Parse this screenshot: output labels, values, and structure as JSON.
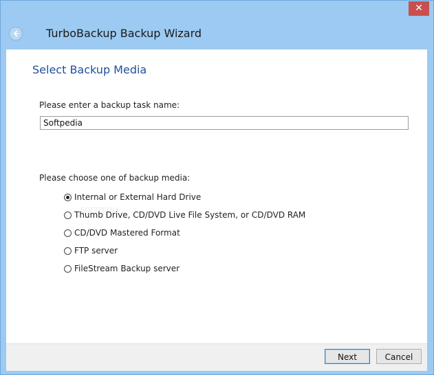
{
  "window": {
    "title": "TurboBackup Backup Wizard",
    "close_glyph": "✕"
  },
  "header": {
    "back_icon": "back-arrow-icon"
  },
  "page": {
    "section_title": "Select Backup Media",
    "task_name_label": "Please enter a backup task name:",
    "task_name_value": "Softpedia",
    "media_label": "Please choose one of backup media:",
    "options": [
      {
        "label": "Internal or External Hard Drive",
        "selected": true
      },
      {
        "label": "Thumb Drive, CD/DVD Live File System, or CD/DVD RAM",
        "selected": false
      },
      {
        "label": "CD/DVD Mastered Format",
        "selected": false
      },
      {
        "label": "FTP server",
        "selected": false
      },
      {
        "label": "FileStream Backup server",
        "selected": false
      }
    ]
  },
  "footer": {
    "next_label": "Next",
    "cancel_label": "Cancel"
  },
  "colors": {
    "frame": "#9ccaf2",
    "close_button": "#c7504e",
    "section_title": "#1f4f99"
  }
}
